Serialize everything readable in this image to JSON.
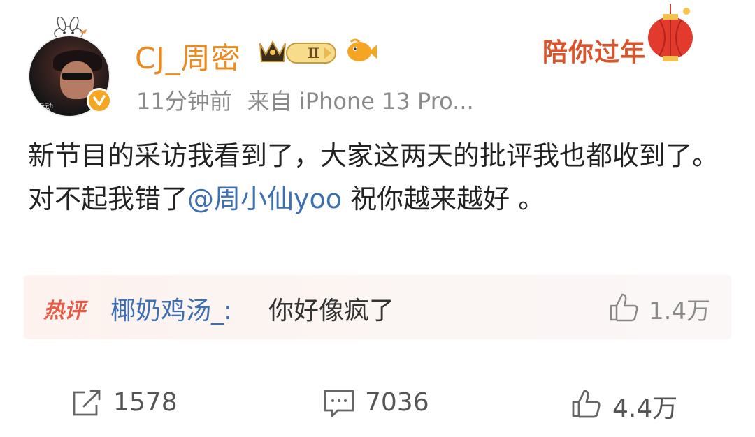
{
  "post": {
    "username": "CJ_周密",
    "time": "11分钟前",
    "source": "来自 iPhone 13 Pro...",
    "promo_text": "陪你过年",
    "content_part1": "新节目的采访我看到了，大家这两天的批评我也都收到了。对不起我错了",
    "mention": "@周小仙yoo",
    "content_part2": " 祝你越来越好 。",
    "crown_level": "Ⅱ"
  },
  "hot_comment": {
    "tag": "热评",
    "user": "椰奶鸡汤_",
    "separator": ":",
    "text": "你好像疯了",
    "likes": "1.4万"
  },
  "actions": {
    "repost_count": "1578",
    "comment_count": "7036",
    "like_count": "4.4万"
  },
  "colors": {
    "username": "#ee8a1d",
    "mention": "#3d6fb3",
    "hot_tag": "#e65b46",
    "meta": "#8a8a8a"
  },
  "icons": [
    "bunny-icon",
    "verified-icon",
    "crown-badge-icon",
    "fish-icon",
    "lantern-icon",
    "repost-icon",
    "comment-icon",
    "like-icon"
  ]
}
